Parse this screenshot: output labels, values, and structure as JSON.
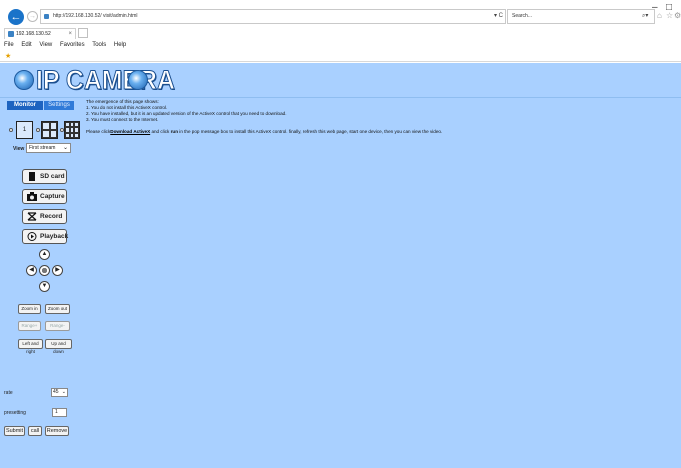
{
  "browser": {
    "address_url": "http://192.168.130.52/ visit/admin.html",
    "search_placeholder": "Search...",
    "tab_title": "192.168.130.52",
    "menu": [
      "File",
      "Edit",
      "View",
      "Favorites",
      "Tools",
      "Help"
    ],
    "window_controls": {
      "minimize": "–",
      "maximize": "□"
    }
  },
  "header": {
    "title": "IP CAMERA"
  },
  "tabs": {
    "monitor": "Monitor",
    "settings": "Settings"
  },
  "layout_options": {
    "single": "1"
  },
  "view": {
    "label": "View",
    "selected": "First stream"
  },
  "buttons": {
    "sd_card": "SD card",
    "capture": "Capture",
    "record": "Record",
    "playback": "Playback",
    "zoom_in": "Zoom in",
    "zoom_out": "Zoom out",
    "range_1": "Range+",
    "range_2": "Range-",
    "left_right": "Left and right",
    "up_down": "Up and down",
    "submit": "Submit",
    "call": "call",
    "remove": "Remove"
  },
  "ptz": {
    "up": "▲",
    "down": "▼",
    "left": "◀",
    "right": "▶"
  },
  "rate": {
    "label": "rate",
    "value": "45"
  },
  "presetting": {
    "label": "presetting",
    "value": "1"
  },
  "message": {
    "intro": "The emergence of this page shows:",
    "line1": "1. You do not install this ActiveX control.",
    "line2": "2. You have installed, but it is an updated version of the ActiveX control that you need to download.",
    "line3": "3. You must connect to the Internet.",
    "line4_pre": "Please click",
    "download_link": "Download ActiveX",
    "line4_mid": " and click ",
    "run_word": "run",
    "line4_post": " in the pop message box to install this ActiveX control. finally, refresh this web page, start one device, then you can view the video."
  }
}
